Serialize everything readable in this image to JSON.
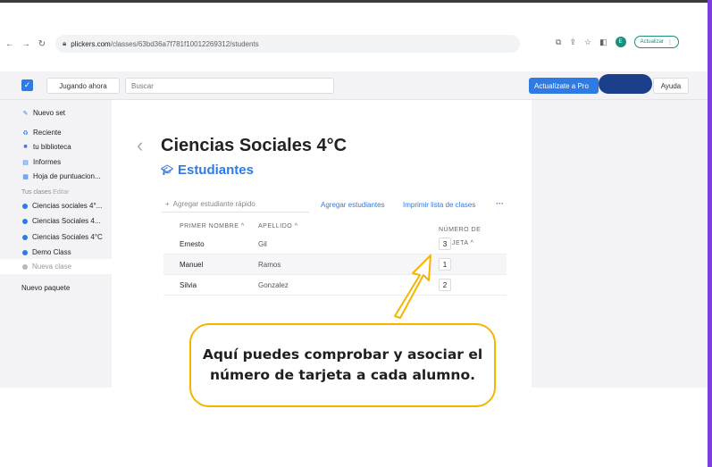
{
  "browser": {
    "url_host": "plickers.com",
    "url_path": "/classes/63bd36a7f781f10012269312/students",
    "profile_initial": "E",
    "update_label": "Actualizar"
  },
  "header": {
    "playing_label": "Jugando ahora",
    "search_placeholder": "Buscar",
    "pro_label": "Actualízate a Pro",
    "help_label": "Ayuda"
  },
  "sidebar": {
    "items": [
      {
        "label": "Nuevo set",
        "icon": "edit-icon"
      },
      {
        "label": "Reciente",
        "icon": "recent-icon"
      },
      {
        "label": "tu biblioteca",
        "icon": "folder-icon"
      },
      {
        "label": "Informes",
        "icon": "report-icon"
      },
      {
        "label": "Hoja de puntuacion...",
        "icon": "grid-icon"
      }
    ],
    "classes_heading": "Tus clases",
    "edit_label": "Editar",
    "classes": [
      {
        "label": "Ciencias sociales 4°..."
      },
      {
        "label": "Ciencias Sociales 4..."
      },
      {
        "label": "Ciencias Sociales 4°C"
      },
      {
        "label": "Demo Class"
      },
      {
        "label": "Nueva clase"
      }
    ],
    "new_pack": "Nuevo paquete"
  },
  "main": {
    "class_title": "Ciencias Sociales 4°C",
    "section_title": "Estudiantes",
    "quick_add_placeholder": "Agregar estudiante rápido",
    "add_students": "Agregar estudiantes",
    "print_list": "Imprimir lista de clases",
    "more": "···",
    "columns": {
      "first_name": "PRIMER NOMBRE",
      "last_name": "APELLIDO",
      "card_number": "NÚMERO DE TARJETA"
    },
    "students": [
      {
        "first": "Ernesto",
        "last": "Gil",
        "card": "3"
      },
      {
        "first": "Manuel",
        "last": "Ramos",
        "card": "1"
      },
      {
        "first": "Silvia",
        "last": "Gonzalez",
        "card": "2"
      }
    ]
  },
  "callout": {
    "text": "Aquí puedes comprobar y asociar el número de tarjeta a cada alumno."
  },
  "colors": {
    "accent": "#2f7be3",
    "callout_border": "#f5b400",
    "frame_border": "#7b3fe0"
  }
}
